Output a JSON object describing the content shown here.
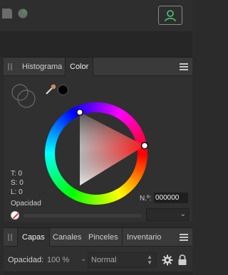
{
  "toolbar": {
    "icons": [
      "palette-icon",
      "shapes-icon",
      "user-icon"
    ]
  },
  "color_panel": {
    "tabs": [
      {
        "label": "Histograma",
        "active": false
      },
      {
        "label": "Color",
        "active": true
      }
    ],
    "hsl": {
      "t": "T: 0",
      "s": "S: 0",
      "l": "L: 0"
    },
    "opacity_label": "Opacidad",
    "hex_label": "N.º:",
    "hex_value": "000000",
    "current_color": "#000000",
    "selected_hue_color": "#ff0000"
  },
  "layers_panel": {
    "tabs": [
      {
        "label": "Capas",
        "active": true
      },
      {
        "label": "Canales",
        "active": false
      },
      {
        "label": "Pinceles",
        "active": false
      },
      {
        "label": "Inventario",
        "active": false
      }
    ],
    "opacity_label": "Opacidad:",
    "opacity_value": "100 %",
    "blend_mode": "Normal"
  }
}
